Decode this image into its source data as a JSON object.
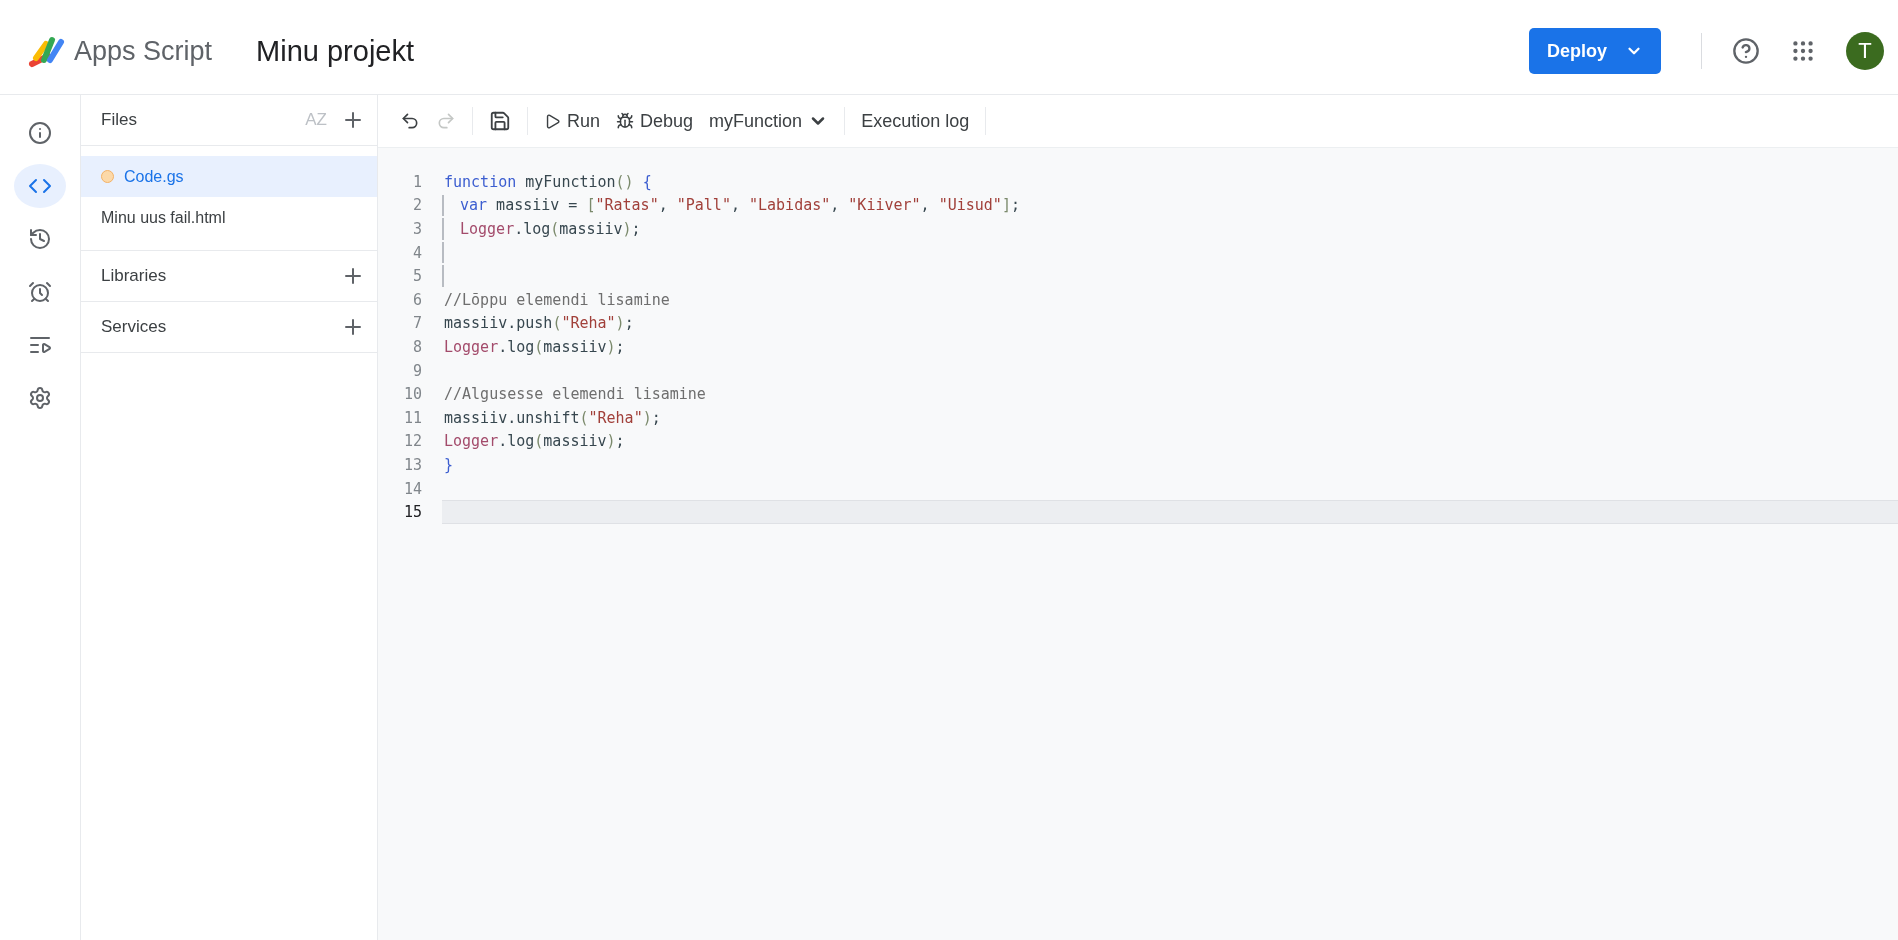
{
  "header": {
    "product": "Apps Script",
    "project": "Minu projekt",
    "deploy": "Deploy",
    "avatar": "T"
  },
  "rail": [
    {
      "selected": false
    },
    {
      "selected": true
    },
    {
      "selected": false
    },
    {
      "selected": false
    },
    {
      "selected": false
    },
    {
      "selected": false
    }
  ],
  "files": {
    "title": "Files",
    "sort_label": "AZ",
    "items": [
      {
        "name": "Code.gs",
        "selected": true,
        "unsaved": true
      },
      {
        "name": "Minu uus fail.html",
        "selected": false,
        "unsaved": false
      }
    ]
  },
  "sections": [
    "Libraries",
    "Services"
  ],
  "toolbar": {
    "run": "Run",
    "debug": "Debug",
    "function": "myFunction",
    "log": "Execution log",
    "redo_disabled": true
  },
  "code": [
    {
      "number": "1",
      "selected": false,
      "indented": false,
      "tokens": [
        {
          "kind": "keyword",
          "text": "function"
        },
        {
          "kind": "plain",
          "text": " myFunction"
        },
        {
          "kind": "punct",
          "text": "()"
        },
        {
          "kind": "keyword",
          "text": " {"
        }
      ]
    },
    {
      "number": "2",
      "selected": false,
      "indented": true,
      "tokens": [
        {
          "kind": "keyword",
          "text": "var"
        },
        {
          "kind": "plain",
          "text": " massiiv = "
        },
        {
          "kind": "punct",
          "text": "["
        },
        {
          "kind": "string",
          "text": "\"Ratas\""
        },
        {
          "kind": "plain",
          "text": ", "
        },
        {
          "kind": "string",
          "text": "\"Pall\""
        },
        {
          "kind": "plain",
          "text": ", "
        },
        {
          "kind": "string",
          "text": "\"Labidas\""
        },
        {
          "kind": "plain",
          "text": ", "
        },
        {
          "kind": "string",
          "text": "\"Kiiver\""
        },
        {
          "kind": "plain",
          "text": ", "
        },
        {
          "kind": "string",
          "text": "\"Uisud\""
        },
        {
          "kind": "punct",
          "text": "]"
        },
        {
          "kind": "plain",
          "text": ";"
        }
      ]
    },
    {
      "number": "3",
      "selected": false,
      "indented": true,
      "tokens": [
        {
          "kind": "builtin",
          "text": "Logger"
        },
        {
          "kind": "plain",
          "text": ".log"
        },
        {
          "kind": "punct",
          "text": "("
        },
        {
          "kind": "plain",
          "text": "massiiv"
        },
        {
          "kind": "punct",
          "text": ")"
        },
        {
          "kind": "plain",
          "text": ";"
        }
      ]
    },
    {
      "number": "4",
      "selected": false,
      "indented": true
    },
    {
      "number": "5",
      "selected": false,
      "indented": true
    },
    {
      "number": "6",
      "selected": false,
      "indented": false,
      "tokens": [
        {
          "kind": "comment",
          "text": "//Lõppu elemendi lisamine"
        }
      ]
    },
    {
      "number": "7",
      "selected": false,
      "indented": false,
      "tokens": [
        {
          "kind": "plain",
          "text": "massiiv.push"
        },
        {
          "kind": "punct",
          "text": "("
        },
        {
          "kind": "string",
          "text": "\"Reha\""
        },
        {
          "kind": "punct",
          "text": ")"
        },
        {
          "kind": "plain",
          "text": ";"
        }
      ]
    },
    {
      "number": "8",
      "selected": false,
      "indented": false,
      "tokens": [
        {
          "kind": "builtin",
          "text": "Logger"
        },
        {
          "kind": "plain",
          "text": ".log"
        },
        {
          "kind": "punct",
          "text": "("
        },
        {
          "kind": "plain",
          "text": "massiiv"
        },
        {
          "kind": "punct",
          "text": ")"
        },
        {
          "kind": "plain",
          "text": ";"
        }
      ]
    },
    {
      "number": "9",
      "selected": false,
      "indented": false
    },
    {
      "number": "10",
      "selected": false,
      "indented": false,
      "tokens": [
        {
          "kind": "comment",
          "text": "//Algusesse elemendi lisamine"
        }
      ]
    },
    {
      "number": "11",
      "selected": false,
      "indented": false,
      "tokens": [
        {
          "kind": "plain",
          "text": "massiiv.unshift"
        },
        {
          "kind": "punct",
          "text": "("
        },
        {
          "kind": "string",
          "text": "\"Reha\""
        },
        {
          "kind": "punct",
          "text": ")"
        },
        {
          "kind": "plain",
          "text": ";"
        }
      ]
    },
    {
      "number": "12",
      "selected": false,
      "indented": false,
      "tokens": [
        {
          "kind": "builtin",
          "text": "Logger"
        },
        {
          "kind": "plain",
          "text": ".log"
        },
        {
          "kind": "punct",
          "text": "("
        },
        {
          "kind": "plain",
          "text": "massiiv"
        },
        {
          "kind": "punct",
          "text": ")"
        },
        {
          "kind": "plain",
          "text": ";"
        }
      ]
    },
    {
      "number": "13",
      "selected": false,
      "indented": false,
      "tokens": [
        {
          "kind": "keyword",
          "text": "}"
        }
      ]
    },
    {
      "number": "14",
      "selected": false,
      "indented": false
    },
    {
      "number": "15",
      "selected": true,
      "indented": false
    }
  ]
}
